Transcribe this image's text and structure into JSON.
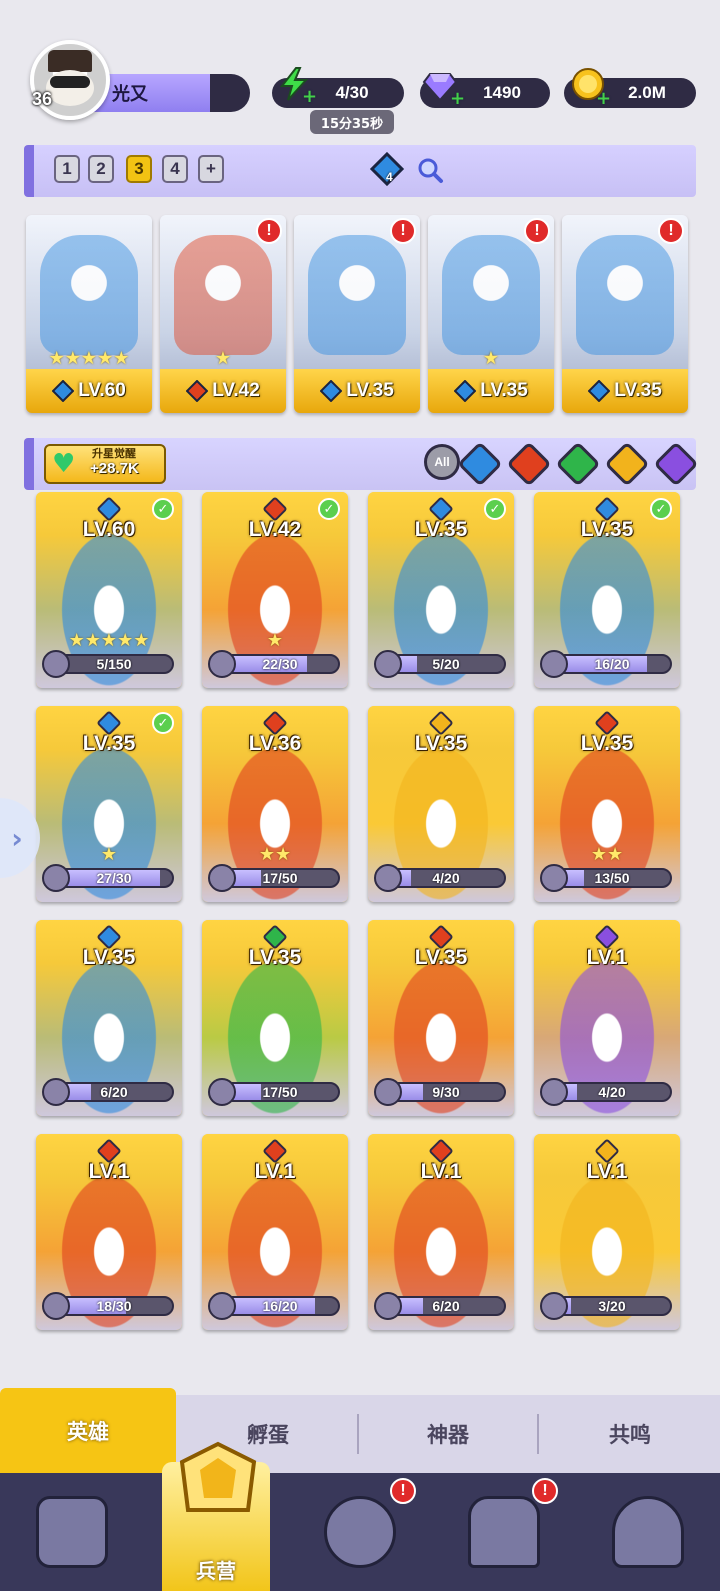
{
  "player": {
    "level": "36",
    "name": "光又"
  },
  "resources": {
    "energy": {
      "icon": "lightning-icon",
      "value": "4/30",
      "timer": "15分35秒"
    },
    "gems": {
      "icon": "diamond-icon",
      "value": "1490"
    },
    "gold": {
      "icon": "coin-icon",
      "value": "2.0M"
    }
  },
  "team_pages": {
    "pages": [
      "1",
      "2",
      "3",
      "4"
    ],
    "active": "3",
    "add_label": "+",
    "crystal_count": "4"
  },
  "team": [
    {
      "element": "water",
      "level": "LV.60",
      "stars": "★★★★★",
      "alert": false
    },
    {
      "element": "fire",
      "level": "LV.42",
      "stars": "★",
      "alert": true
    },
    {
      "element": "water",
      "level": "LV.35",
      "stars": "",
      "alert": true
    },
    {
      "element": "water",
      "level": "LV.35",
      "stars": "★",
      "alert": true
    },
    {
      "element": "water",
      "level": "LV.35",
      "stars": "",
      "alert": true
    }
  ],
  "upgrade": {
    "title": "升星觉醒",
    "value": "+28.7K"
  },
  "filters": {
    "all_label": "All",
    "elements": [
      "water",
      "fire",
      "nature",
      "light",
      "dark"
    ]
  },
  "heroes": [
    {
      "element": "water",
      "level": "LV.60",
      "stars": "★★★★★",
      "progress": "5/150",
      "fraction": 0.033,
      "checked": true
    },
    {
      "element": "fire",
      "level": "LV.42",
      "stars": "★",
      "progress": "22/30",
      "fraction": 0.733,
      "checked": true
    },
    {
      "element": "water",
      "level": "LV.35",
      "stars": "",
      "progress": "5/20",
      "fraction": 0.25,
      "checked": true
    },
    {
      "element": "water",
      "level": "LV.35",
      "stars": "",
      "progress": "16/20",
      "fraction": 0.8,
      "checked": true
    },
    {
      "element": "water",
      "level": "LV.35",
      "stars": "★",
      "progress": "27/30",
      "fraction": 0.9,
      "checked": true
    },
    {
      "element": "fire",
      "level": "LV.36",
      "stars": "★★",
      "progress": "17/50",
      "fraction": 0.34,
      "checked": false
    },
    {
      "element": "light",
      "level": "LV.35",
      "stars": "",
      "progress": "4/20",
      "fraction": 0.2,
      "checked": false
    },
    {
      "element": "fire",
      "level": "LV.35",
      "stars": "★★",
      "progress": "13/50",
      "fraction": 0.26,
      "checked": false
    },
    {
      "element": "water",
      "level": "LV.35",
      "stars": "",
      "progress": "6/20",
      "fraction": 0.3,
      "checked": false
    },
    {
      "element": "nature",
      "level": "LV.35",
      "stars": "",
      "progress": "17/50",
      "fraction": 0.34,
      "checked": false
    },
    {
      "element": "fire",
      "level": "LV.35",
      "stars": "",
      "progress": "9/30",
      "fraction": 0.3,
      "checked": false
    },
    {
      "element": "dark",
      "level": "LV.1",
      "stars": "",
      "progress": "4/20",
      "fraction": 0.2,
      "checked": false
    },
    {
      "element": "fire",
      "level": "LV.1",
      "stars": "",
      "progress": "18/30",
      "fraction": 0.6,
      "checked": false
    },
    {
      "element": "fire",
      "level": "LV.1",
      "stars": "",
      "progress": "16/20",
      "fraction": 0.8,
      "checked": false
    },
    {
      "element": "fire",
      "level": "LV.1",
      "stars": "",
      "progress": "6/20",
      "fraction": 0.3,
      "checked": false
    },
    {
      "element": "light",
      "level": "LV.1",
      "stars": "",
      "progress": "3/20",
      "fraction": 0.15,
      "checked": false
    }
  ],
  "sub_tabs": [
    "英雄",
    "孵蛋",
    "神器",
    "共鸣"
  ],
  "nav": {
    "active_label": "兵营"
  },
  "colors": {
    "water": "#2f8be0",
    "fire": "#e0401e",
    "nature": "#2fb54a",
    "light": "#f2b31c",
    "dark": "#8a4fe0",
    "accent": "#f6c514"
  }
}
